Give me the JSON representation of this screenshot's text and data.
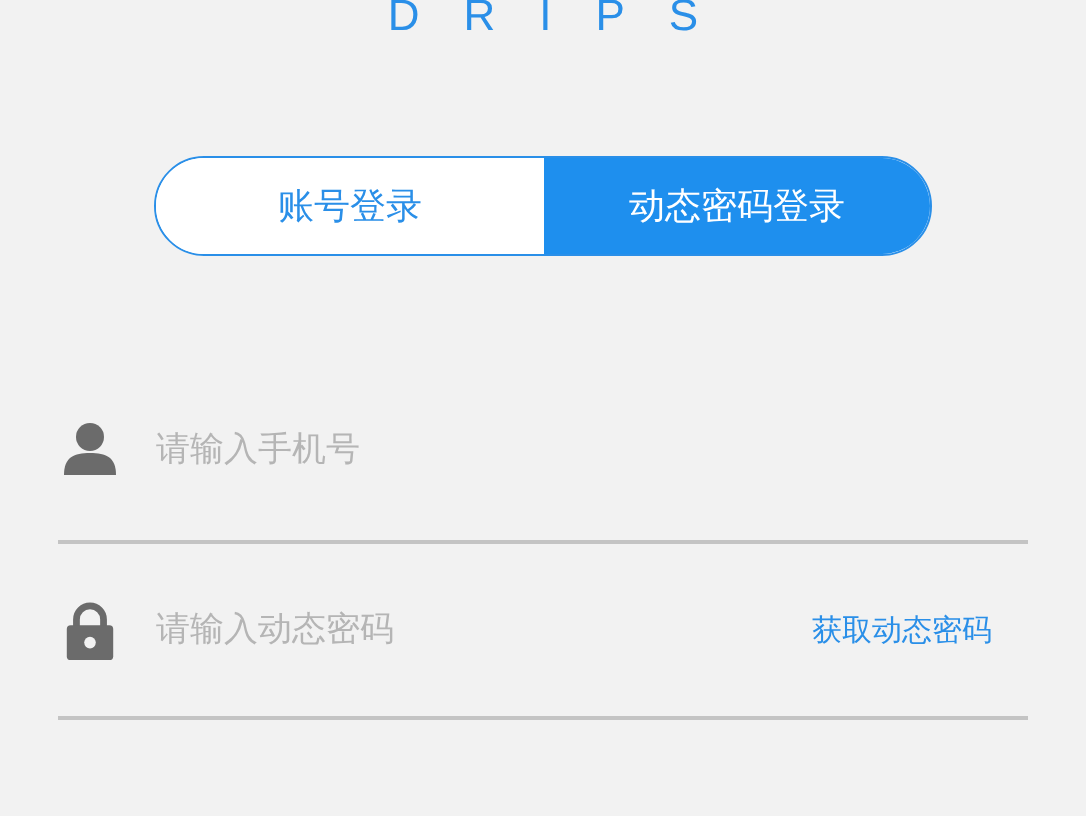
{
  "logo": {
    "text": "DRIPS"
  },
  "tabs": [
    {
      "label": "账号登录",
      "selected": false
    },
    {
      "label": "动态密码登录",
      "selected": true
    }
  ],
  "fields": [
    {
      "kind": "user",
      "placeholder": "请输入手机号"
    },
    {
      "kind": "lock",
      "placeholder": "请输入动态密码",
      "action": "获取动态密码"
    }
  ]
}
